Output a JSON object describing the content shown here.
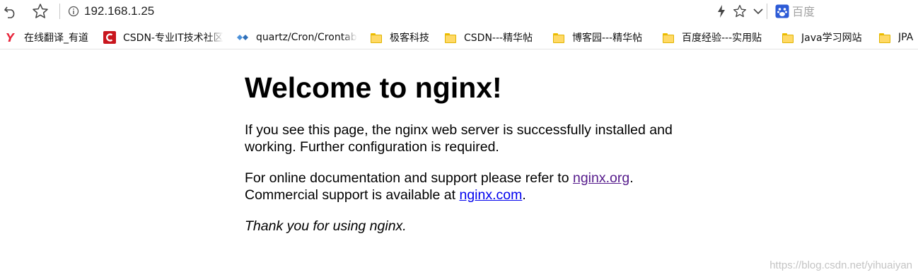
{
  "toolbar": {
    "back_icon": "back-arrow-icon",
    "star_icon": "star-icon",
    "info_icon": "info-icon",
    "url": "192.168.1.25",
    "bolt_icon": "lightning-icon",
    "star2_icon": "star-icon",
    "dropdown_icon": "chevron-down-icon",
    "search_engine_icon": "baidu-paw-icon",
    "search_placeholder": "百度"
  },
  "bookmarks": [
    {
      "label": "在线翻译_有道",
      "icon": "youdao-icon"
    },
    {
      "label": "CSDN-专业IT技术社区",
      "icon": "csdn-icon"
    },
    {
      "label": "quartz/Cron/Crontab",
      "icon": "diamond-icon"
    },
    {
      "label": "极客科技",
      "icon": "folder-icon"
    },
    {
      "label": "CSDN---精华帖",
      "icon": "folder-icon"
    },
    {
      "label": "博客园---精华帖",
      "icon": "folder-icon"
    },
    {
      "label": "百度经验---实用贴",
      "icon": "folder-icon"
    },
    {
      "label": "Java学习网站",
      "icon": "folder-icon"
    },
    {
      "label": "JPA",
      "icon": "folder-icon"
    }
  ],
  "page": {
    "title": "Welcome to nginx!",
    "p1": "If you see this page, the nginx web server is successfully installed and working. Further configuration is required.",
    "p2_before": "For online documentation and support please refer to ",
    "p2_link": "nginx.org",
    "p2_after": ".",
    "p2b_before": "Commercial support is available at ",
    "p2b_link": "nginx.com",
    "p2b_after": ".",
    "p3": "Thank you for using nginx."
  },
  "colors": {
    "link": "#0000ee",
    "visited_link": "#551a8b",
    "csdn_red": "#c9161e",
    "youdao_red": "#e8243a",
    "folder_yellow": "#ffd966"
  },
  "watermark": "https://blog.csdn.net/yihuaiyan"
}
